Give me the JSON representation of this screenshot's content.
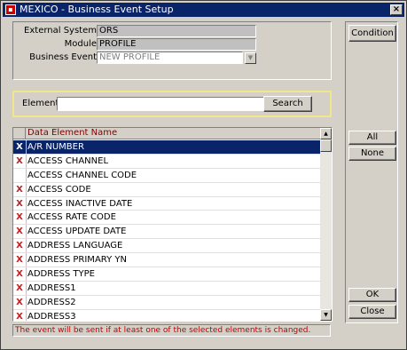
{
  "window": {
    "title": "MEXICO - Business Event Setup",
    "close_glyph": "×"
  },
  "form": {
    "external_system_label": "External System",
    "external_system_value": "ORS",
    "module_label": "Module",
    "module_value": "PROFILE",
    "business_event_label": "Business Event",
    "business_event_value": "NEW PROFILE"
  },
  "search": {
    "element_label": "Element",
    "element_value": "",
    "search_button": "Search"
  },
  "grid": {
    "column_header": "Data Element Name",
    "rows": [
      {
        "checked": true,
        "name": "A/R NUMBER",
        "selected": true
      },
      {
        "checked": true,
        "name": "ACCESS CHANNEL"
      },
      {
        "checked": false,
        "name": "ACCESS CHANNEL CODE"
      },
      {
        "checked": true,
        "name": "ACCESS CODE"
      },
      {
        "checked": true,
        "name": "ACCESS INACTIVE DATE"
      },
      {
        "checked": true,
        "name": "ACCESS RATE CODE"
      },
      {
        "checked": true,
        "name": "ACCESS UPDATE DATE"
      },
      {
        "checked": true,
        "name": "ADDRESS LANGUAGE"
      },
      {
        "checked": true,
        "name": "ADDRESS PRIMARY YN"
      },
      {
        "checked": true,
        "name": "ADDRESS TYPE"
      },
      {
        "checked": true,
        "name": "ADDRESS1"
      },
      {
        "checked": true,
        "name": "ADDRESS2"
      },
      {
        "checked": true,
        "name": "ADDRESS3"
      }
    ],
    "check_glyph": "X"
  },
  "status_message": "The event will be sent if at least one of the selected elements is changed.",
  "side_buttons": {
    "condition": "Condition",
    "all": "All",
    "none": "None",
    "ok": "OK",
    "close": "Close"
  }
}
